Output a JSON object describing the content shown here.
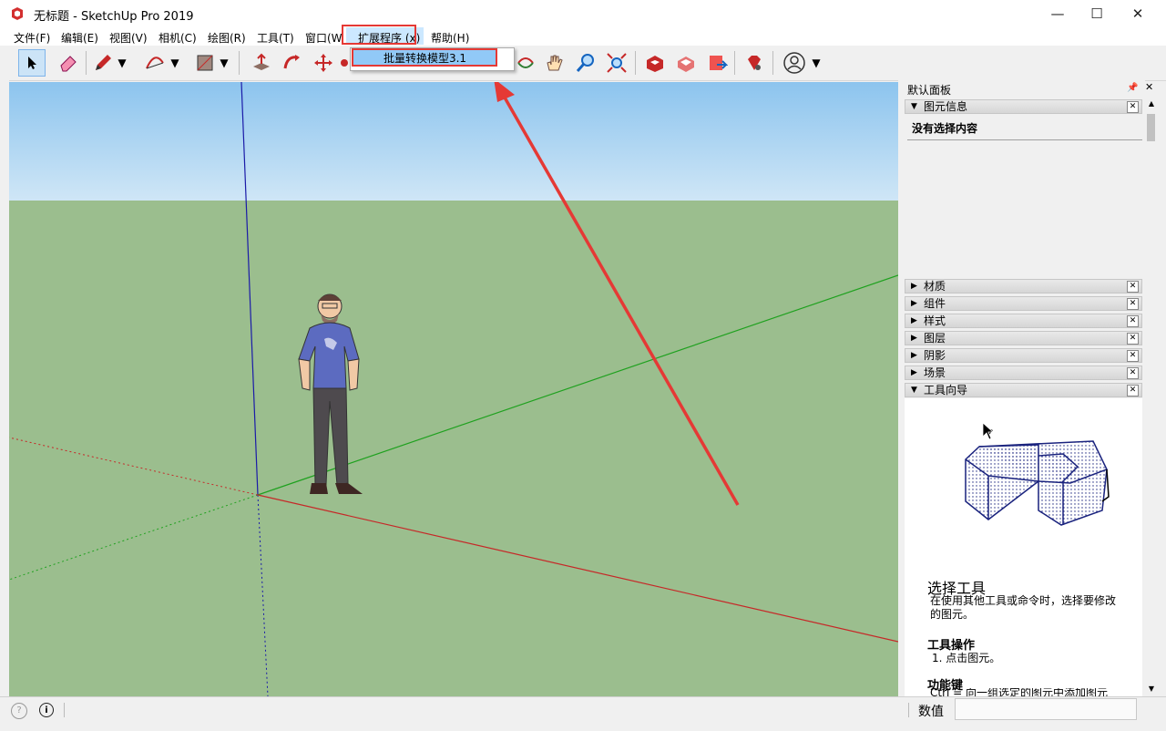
{
  "window": {
    "title": "无标题 - SketchUp Pro 2019",
    "minimize": "—",
    "maximize": "☐",
    "close": "✕"
  },
  "menu": {
    "items": [
      "文件(F)",
      "编辑(E)",
      "视图(V)",
      "相机(C)",
      "绘图(R)",
      "工具(T)",
      "窗口(W)",
      "扩展程序 (x)",
      "帮助(H)"
    ]
  },
  "dropdown": {
    "item": "批量转换模型3.1"
  },
  "panel": {
    "title": "默认面板",
    "entity_info": {
      "header": "图元信息",
      "empty": "没有选择内容"
    },
    "collapsed": [
      "材质",
      "组件",
      "样式",
      "图层",
      "阴影",
      "场景"
    ],
    "instructor": {
      "header": "工具向导",
      "tool_title": "选择工具",
      "tool_desc": "在使用其他工具或命令时，选择要修改的图元。",
      "ops_title": "工具操作",
      "ops_item": "1. 点击图元。",
      "keys_title": "功能键",
      "keys_item": "Ctrl = 向一组选定的图元中添加图元"
    }
  },
  "status": {
    "measurement_label": "数值",
    "measurement_value": ""
  },
  "colors": {
    "sky_top": "#8cc4ee",
    "sky_bottom": "#cfe6f6",
    "ground": "#9bbe8e",
    "highlight_red": "#e53935",
    "menu_highlight": "#cce8ff",
    "dropdown_highlight": "#91c9f7"
  }
}
